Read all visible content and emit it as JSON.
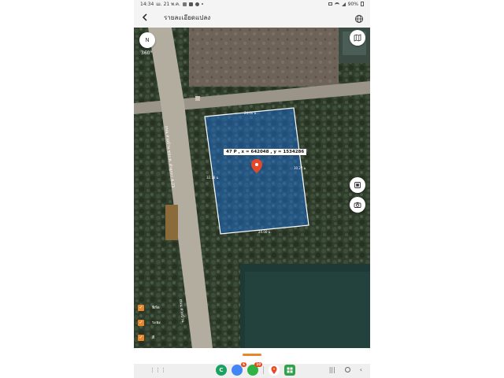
{
  "status_bar": {
    "time": "14:34",
    "date": "ш. 21 พ.ค.",
    "battery": "90%",
    "notification_icons": [
      "image-icon",
      "facebook-icon",
      "messenger-icon"
    ]
  },
  "header": {
    "title": "รายละเอียดแปลง",
    "back_icon": "chevron-left-icon",
    "globe_icon": "globe-icon"
  },
  "map": {
    "compass_symbol": "N",
    "view_label": "360°",
    "parcel_label": "47 P , x = 642048 , y = 1534286",
    "dimension_labels": {
      "top": "24.00 ม.",
      "right": "30.27 ม.",
      "left": "32.18 ม.",
      "bottom": "24.00 ม."
    },
    "road_label_1": "ถนน สายบ้าน ของ ต. ลำลูกกา 4-23",
    "road_label_2": "ถนน สายบ้าน",
    "parcel_color": "#1a73e8",
    "parcel_border": "#ffffff",
    "pin_color": "#e8472a"
  },
  "legend": {
    "items": [
      {
        "label": "พิกัด",
        "checked": true
      },
      {
        "label": "ระยะ",
        "checked": true
      },
      {
        "label": "สี",
        "checked": true
      }
    ],
    "accent": "#e8872a"
  },
  "dock": {
    "apps": [
      {
        "name": "line-icon",
        "letter": "C",
        "color": "#1aa260",
        "badge": ""
      },
      {
        "name": "chrome-icon",
        "letter": "",
        "color": "#4285f4",
        "badge": "6"
      },
      {
        "name": "chat-icon",
        "letter": "",
        "color": "#2fb344",
        "badge": "10"
      },
      {
        "name": "maps-icon",
        "letter": "",
        "color": "#ffffff",
        "badge": ""
      },
      {
        "name": "grid-app-icon",
        "letter": "",
        "color": "#31a24c",
        "badge": ""
      }
    ]
  }
}
